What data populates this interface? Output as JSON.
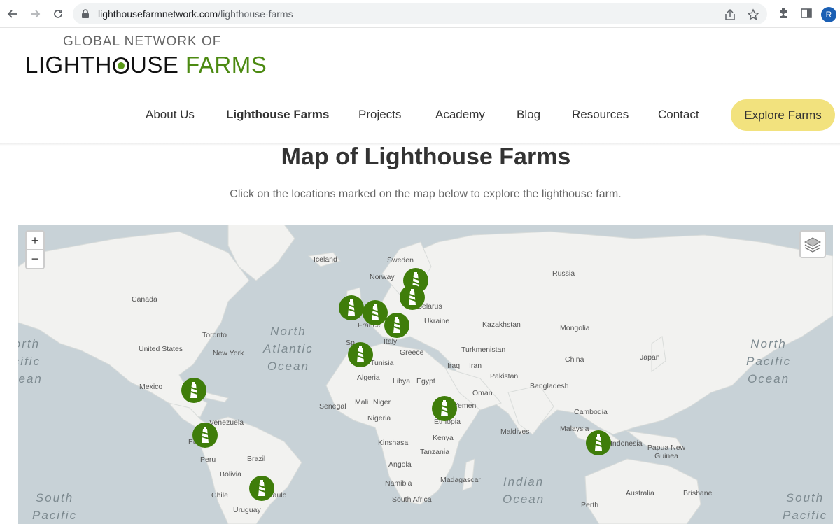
{
  "browser": {
    "url_host": "lighthousefarmnetwork.com",
    "url_path": "/lighthouse-farms",
    "profile_initial": "R"
  },
  "site": {
    "logo_top": "GLOBAL NETWORK OF",
    "logo_main_pre": "LIGHTH",
    "logo_main_post": "USE",
    "logo_farms": "FARMS",
    "nav": [
      "About Us",
      "Lighthouse Farms",
      "Projects",
      "Academy",
      "Blog",
      "Resources",
      "Contact"
    ],
    "active_nav": "Lighthouse Farms",
    "cta": "Explore Farms",
    "cta_color": "#f2e27e",
    "accent_color": "#4c8a12"
  },
  "page": {
    "title": "Map of Lighthouse Farms",
    "subtitle": "Click on the locations marked on the map below to explore the lighthouse farm."
  },
  "map": {
    "zoom_in": "+",
    "zoom_out": "−",
    "marker_color": "#3f7d0a",
    "marker_icon": "lighthouse-icon",
    "marker_count": 14,
    "labels": [
      "Iceland",
      "Sweden",
      "Norway",
      "Russia",
      "Canada",
      "Toronto",
      "New York",
      "United States",
      "Mexico",
      "Kazakhstan",
      "Mongolia",
      "China",
      "Japan",
      "Turkmenistan",
      "Iraq",
      "Iran",
      "Pakistan",
      "Bangladesh",
      "Oman",
      "Yemen",
      "Algeria",
      "Libya",
      "Egypt",
      "Tunisia",
      "Greece",
      "Italy",
      "France",
      "Ukraine",
      "Belarus",
      "Senegal",
      "Mali",
      "Niger",
      "Nigeria",
      "Ethiopia",
      "Kenya",
      "Tanzania",
      "Kinshasa",
      "Angola",
      "Namibia",
      "Madagascar",
      "South Africa",
      "Venezuela",
      "Peru",
      "Brazil",
      "Bolivia",
      "Chile",
      "Uruguay",
      "São Paulo",
      "Ec",
      "Sp",
      "Maldives",
      "Malaysia",
      "Cambodia",
      "Indonesia",
      "Papua New Guinea",
      "Australia",
      "Brisbane",
      "Perth"
    ],
    "oceans": [
      "North Atlantic Ocean",
      "North Pacific Ocean",
      "North Pacific Ocean",
      "Indian Ocean",
      "South Pacific",
      "South Pacific"
    ]
  }
}
